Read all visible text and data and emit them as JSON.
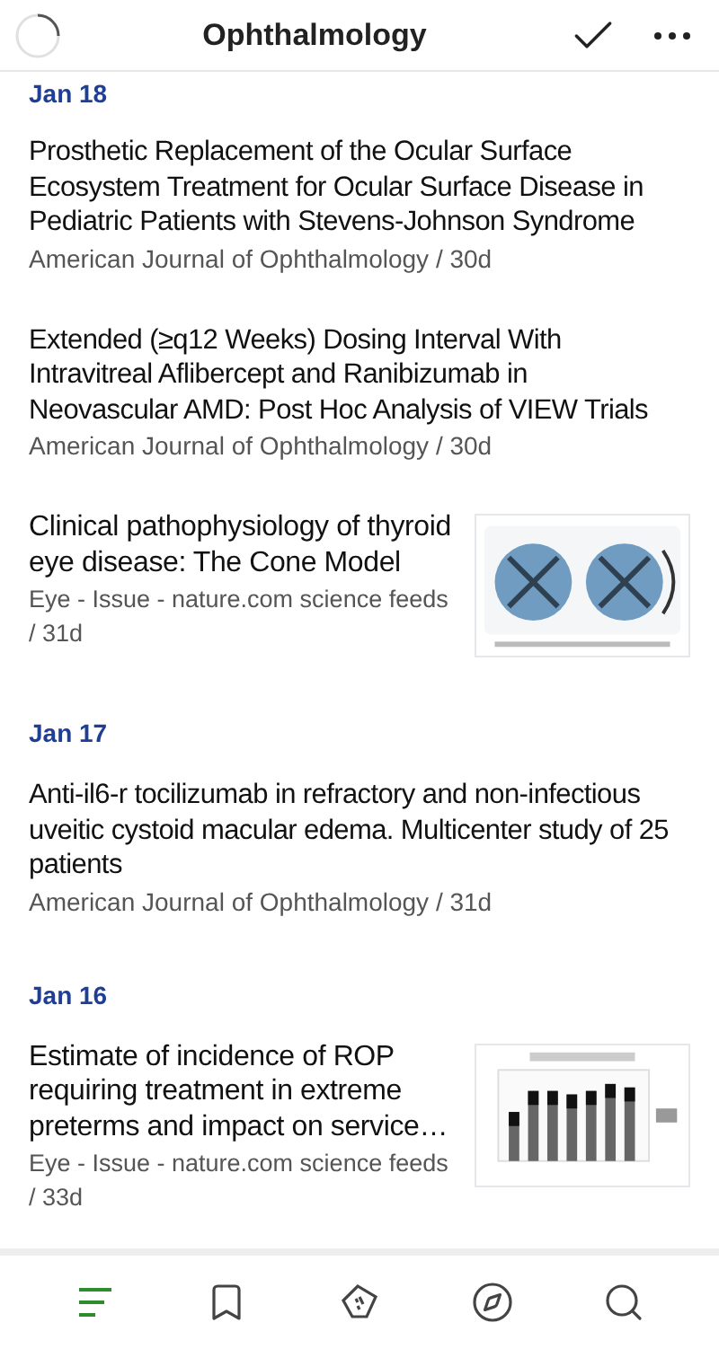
{
  "header": {
    "title": "Ophthalmology",
    "loading": true
  },
  "feed": [
    {
      "kind": "date",
      "label": "Jan 18"
    },
    {
      "kind": "article",
      "title": "Prosthetic Replacement of the Ocular Surface Ecosystem Treatment for Ocular Surface Disease in Pediatric Patients with Stevens-Johnson Syndrome",
      "source": "American Journal of Ophthalmology / 30d",
      "has_image": false
    },
    {
      "kind": "article",
      "title": "Extended (≥q12 Weeks) Dosing Interval With Intravitreal Aflibercept and Ranibizumab in Neovascular AMD: Post Hoc Analysis of VIEW Trials",
      "source": "American Journal of Ophthalmology / 30d",
      "has_image": false
    },
    {
      "kind": "article",
      "title": "Clinical pathophysiology of thyroid eye disease: The Cone Model",
      "source": "Eye - Issue - nature.com science feeds / 31d",
      "has_image": true
    },
    {
      "kind": "date",
      "label": "Jan 17"
    },
    {
      "kind": "article",
      "title": "Anti-il6-r tocilizumab in refractory and non-infectious uveitic cystoid macular edema. Multicenter study of 25 patients",
      "source": "American Journal of Ophthalmology / 31d",
      "has_image": false
    },
    {
      "kind": "date",
      "label": "Jan 16"
    },
    {
      "kind": "article",
      "title": "Estimate of incidence of ROP requiring treatment in extreme preterms and impact on service…",
      "source": "Eye - Issue - nature.com science feeds / 33d",
      "has_image": true
    }
  ],
  "nav": [
    {
      "kind": "feed",
      "selected": true
    },
    {
      "kind": "bookmark",
      "selected": false
    },
    {
      "kind": "board",
      "selected": false
    },
    {
      "kind": "explore",
      "selected": false
    },
    {
      "kind": "search",
      "selected": false
    }
  ]
}
